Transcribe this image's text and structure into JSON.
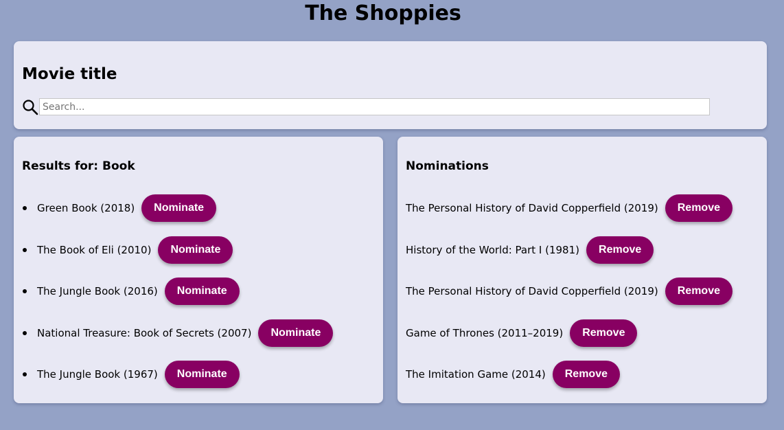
{
  "header": {
    "title": "The Shoppies"
  },
  "search": {
    "heading": "Movie title",
    "placeholder": "Search...",
    "value": ""
  },
  "results": {
    "heading": "Results for: Book",
    "button_label": "Nominate",
    "items": [
      {
        "label": "Green Book (2018)"
      },
      {
        "label": "The Book of Eli (2010)"
      },
      {
        "label": "The Jungle Book (2016)"
      },
      {
        "label": "National Treasure: Book of Secrets (2007)"
      },
      {
        "label": "The Jungle Book (1967)"
      }
    ]
  },
  "nominations": {
    "heading": "Nominations",
    "button_label": "Remove",
    "items": [
      {
        "label": "The Personal History of David Copperfield (2019)"
      },
      {
        "label": "History of the World: Part I (1981)"
      },
      {
        "label": "The Personal History of David Copperfield (2019)"
      },
      {
        "label": "Game of Thrones (2011–2019)"
      },
      {
        "label": "The Imitation Game (2014)"
      }
    ]
  },
  "colors": {
    "page_background": "#94a2c6",
    "card_background": "#e8e8f4",
    "button_background": "#880062",
    "button_text": "#ffffff"
  },
  "icons": {
    "search": "search-icon"
  }
}
